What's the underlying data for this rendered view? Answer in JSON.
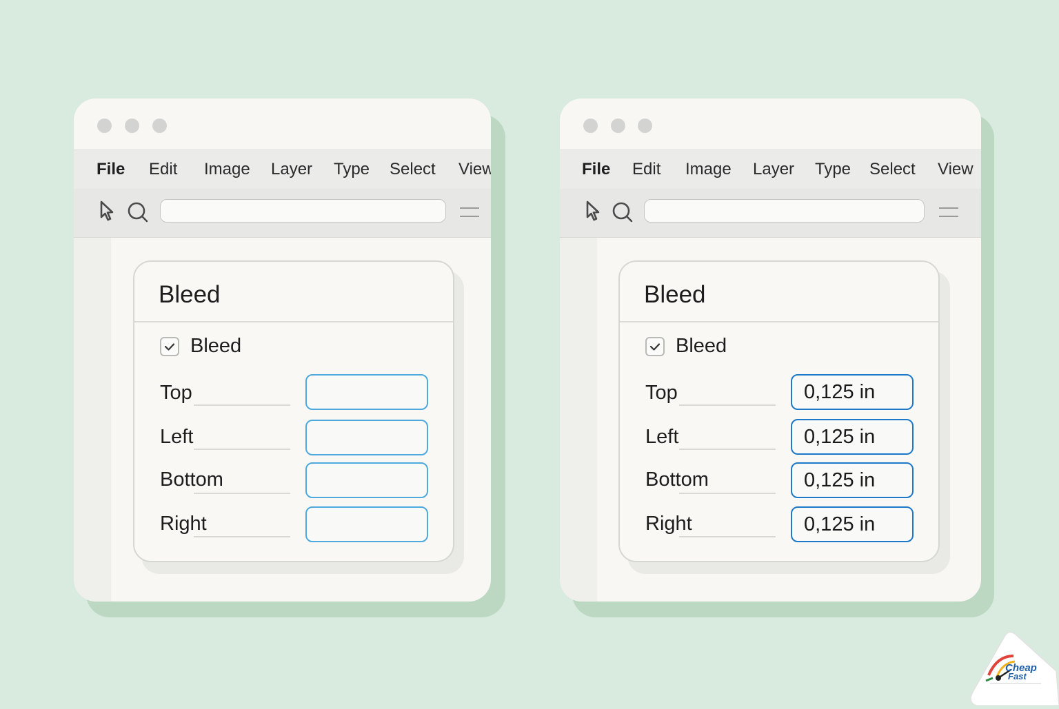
{
  "windows": [
    {
      "menu": [
        "File",
        "Edit",
        "Image",
        "Layer",
        "Type",
        "Select",
        "View"
      ],
      "search": {
        "value": "",
        "placeholder": ""
      },
      "dialog": {
        "title": "Bleed",
        "checkbox_label": "Bleed",
        "checked": true,
        "rows": [
          {
            "label": "Top",
            "value": ""
          },
          {
            "label": "Left",
            "value": ""
          },
          {
            "label": "Bottom",
            "value": ""
          },
          {
            "label": "Right",
            "value": ""
          }
        ]
      }
    },
    {
      "menu": [
        "File",
        "Edit",
        "Image",
        "Layer",
        "Type",
        "Select",
        "View"
      ],
      "search": {
        "value": "",
        "placeholder": ""
      },
      "dialog": {
        "title": "Bleed",
        "checkbox_label": "Bleed",
        "checked": true,
        "rows": [
          {
            "label": "Top",
            "value": "0,125 in"
          },
          {
            "label": "Left",
            "value": "0,125 in"
          },
          {
            "label": "Bottom",
            "value": "0,125 in"
          },
          {
            "label": "Right",
            "value": "0,125 in"
          }
        ]
      }
    }
  ],
  "logo": {
    "text_line1": "Cheap",
    "text_line2": "Fast"
  },
  "colors": {
    "background": "#d9eadf",
    "window_shadow": "#bcd8c3",
    "empty_field_border": "#4ea9de",
    "filled_field_border": "#1c78c8"
  }
}
